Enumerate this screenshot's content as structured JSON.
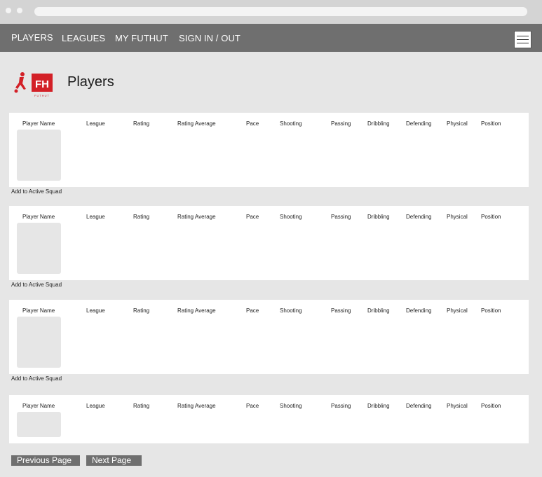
{
  "nav": {
    "links": [
      "PLAYERS",
      "LEAGUES",
      "MY FUTHUT",
      "SIGN IN / OUT"
    ]
  },
  "logo": {
    "text": "FH",
    "subtext": "FUTHUT"
  },
  "page_title": "Players",
  "columns": [
    "Player Name",
    "League",
    "Rating",
    "Rating Average",
    "Pace",
    "Shooting",
    "Passing",
    "Dribbling",
    "Defending",
    "Physical",
    "Position"
  ],
  "add_label": "Add to Active Squad",
  "pagination": {
    "prev": "Previous Page",
    "next": "Next Page"
  },
  "colors": {
    "nav": "#6f6f6f",
    "background": "#e6e6e6",
    "card": "#ffffff",
    "logo_red": "#d32027"
  },
  "icons": {
    "menu": "hamburger-icon",
    "logo": "futhut-logo"
  }
}
